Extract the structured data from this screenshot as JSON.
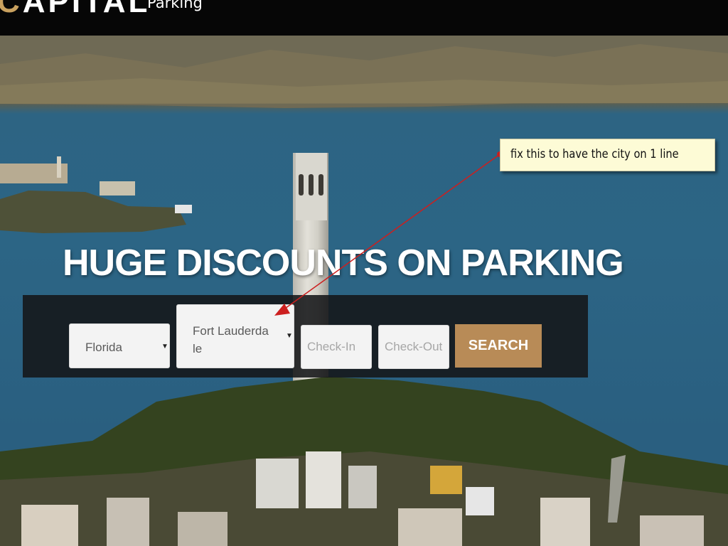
{
  "header": {
    "logo_first": "C",
    "logo_rest": "APITAL",
    "logo_sub": "Parking"
  },
  "hero": {
    "headline": "HUGE DISCOUNTS ON PARKING"
  },
  "search": {
    "state": "Florida",
    "city": "Fort Lauderdale",
    "checkin_placeholder": "Check-In",
    "checkout_placeholder": "Check-Out",
    "search_label": "SEARCH"
  },
  "annotation": {
    "text": "fix this to have the city on 1 line"
  },
  "colors": {
    "accent": "#b88b57",
    "header_bg": "#060606",
    "annotation_arrow": "#cc1f1f"
  },
  "icons": [
    "caret-down-icon"
  ]
}
